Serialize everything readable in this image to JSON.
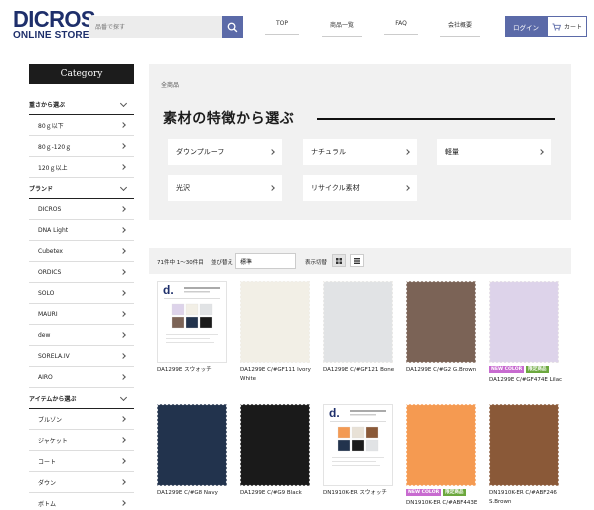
{
  "logo": {
    "line1": "DICROS",
    "line2": "ONLINE STORE"
  },
  "search": {
    "placeholder": "品番で探す",
    "icon": "search-icon"
  },
  "nav": [
    {
      "label": "TOP"
    },
    {
      "label": "商品一覧"
    },
    {
      "label": "FAQ"
    },
    {
      "label": "会社概要"
    }
  ],
  "header": {
    "login_label": "ログイン",
    "cart_label": "カート",
    "cart_icon": "cart-icon"
  },
  "sidebar": {
    "title": "Category",
    "rows": [
      {
        "label": "重さから選ぶ",
        "type": "sec"
      },
      {
        "label": "80ｇ以下",
        "type": "sub"
      },
      {
        "label": "80ｇ-120ｇ",
        "type": "sub"
      },
      {
        "label": "120ｇ以上",
        "type": "sub"
      },
      {
        "label": "ブランド",
        "type": "sec"
      },
      {
        "label": "DICROS",
        "type": "sub"
      },
      {
        "label": "DNA Light",
        "type": "sub"
      },
      {
        "label": "Cubetex",
        "type": "sub"
      },
      {
        "label": "ORDICS",
        "type": "sub"
      },
      {
        "label": "SOLO",
        "type": "sub"
      },
      {
        "label": "MAURI",
        "type": "sub"
      },
      {
        "label": "dew",
        "type": "sub"
      },
      {
        "label": "SORELA.IV",
        "type": "sub"
      },
      {
        "label": "AIRO",
        "type": "sub"
      },
      {
        "label": "アイテムから選ぶ",
        "type": "sec"
      },
      {
        "label": "ブルゾン",
        "type": "sub"
      },
      {
        "label": "ジャケット",
        "type": "sub"
      },
      {
        "label": "コート",
        "type": "sub"
      },
      {
        "label": "ダウン",
        "type": "sub"
      },
      {
        "label": "ボトム",
        "type": "sub"
      }
    ]
  },
  "panel": {
    "breadcrumb": "全商品",
    "title": "素材の特徴から選ぶ",
    "features": [
      {
        "label": "ダウンプルーフ"
      },
      {
        "label": "ナチュラル"
      },
      {
        "label": "軽量"
      },
      {
        "label": "光沢"
      },
      {
        "label": "リサイクル素材"
      }
    ]
  },
  "toolbar": {
    "count": "71件中 1～30件目",
    "sort_label": "並び替え",
    "sort_value": "標準",
    "view_label": "表示切替"
  },
  "badge_labels": {
    "new": "NEW COLOR",
    "limited": "限定商品"
  },
  "colors": {
    "accent": "#5b6aa8",
    "navy_logo": "#1e2f6b",
    "new_badge": "#c86bd0",
    "limited_badge": "#6ca83e"
  },
  "products": [
    {
      "name": "DA1299E スウォッチ",
      "kind": "card",
      "color": "#ffffff",
      "badges": []
    },
    {
      "name": "DA1299E C/#GF111 Ivory White",
      "kind": "fabric",
      "color": "#f2efe6",
      "badges": []
    },
    {
      "name": "DA1299E C/#GF121 Bone",
      "kind": "fabric",
      "color": "#e1e3e5",
      "badges": []
    },
    {
      "name": "DA1299E C/#G2 G.Brown",
      "kind": "fabric",
      "color": "#7b6356",
      "badges": []
    },
    {
      "name": "DA1299E C/#GF474E Lilac",
      "kind": "fabric",
      "color": "#ddd3ea",
      "badges": [
        "new",
        "limited"
      ]
    },
    {
      "name": "DA1299E C/#G8 Navy",
      "kind": "fabric",
      "color": "#22334d",
      "badges": []
    },
    {
      "name": "DA1299E C/#G9 Black",
      "kind": "fabric",
      "color": "#1a1a1a",
      "badges": []
    },
    {
      "name": "DN1910K-ER スウォッチ",
      "kind": "card2",
      "color": "#ffffff",
      "badges": []
    },
    {
      "name": "DN1910K-ER C/#ABF443E",
      "kind": "fabric",
      "color": "#f59a51",
      "badges": [
        "new",
        "limited"
      ]
    },
    {
      "name": "DN1910K-ER C/#ABF246 S.Brown",
      "kind": "fabric",
      "color": "#8a5938",
      "badges": []
    }
  ]
}
